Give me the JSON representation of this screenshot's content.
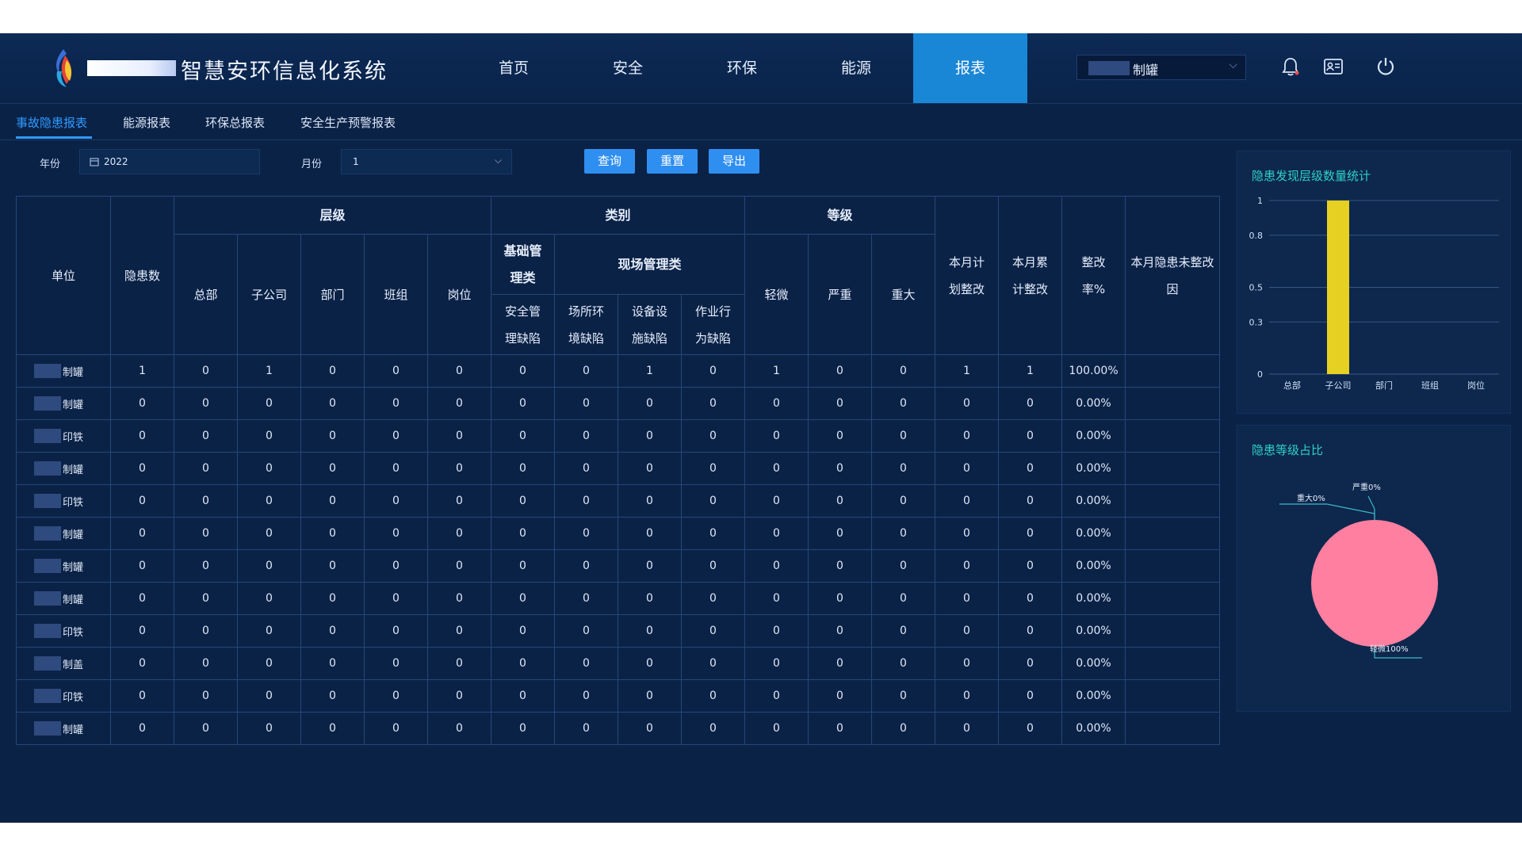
{
  "app": {
    "title": "智慧安环信息化系统",
    "nav": [
      "首页",
      "安全",
      "环保",
      "能源",
      "报表"
    ],
    "active_nav": "报表",
    "org_select": {
      "value": "制罐"
    }
  },
  "subtabs": [
    "事故隐患报表",
    "能源报表",
    "环保总报表",
    "安全生产预警报表"
  ],
  "filters": {
    "year_label": "年份",
    "year_value": "2022",
    "month_label": "月份",
    "month_value": "1",
    "buttons": {
      "query": "查询",
      "reset": "重置",
      "export": "导出"
    }
  },
  "table": {
    "headers": {
      "unit": "单位",
      "count": "隐患数",
      "level_group": "层级",
      "level_cols": [
        "总部",
        "子公司",
        "部门",
        "班组",
        "岗位"
      ],
      "category_group": "类别",
      "basic_mgmt": [
        "基础管",
        "理类"
      ],
      "site_mgmt": "现场管理类",
      "category_cols": [
        [
          "安全管",
          "理缺陷"
        ],
        [
          "场所环",
          "境缺陷"
        ],
        [
          "设备设",
          "施缺陷"
        ],
        [
          "作业行",
          "为缺陷"
        ]
      ],
      "grade_group": "等级",
      "grade_cols": [
        "轻微",
        "严重",
        "重大"
      ],
      "plan": [
        "本月计",
        "划整改"
      ],
      "cumulative": [
        "本月累",
        "计整改"
      ],
      "rate": [
        "整改",
        "率%"
      ],
      "reason": [
        "本月隐患未整改",
        "因"
      ]
    },
    "rows": [
      {
        "unit": "制罐",
        "values": [
          "1",
          "0",
          "1",
          "0",
          "0",
          "0",
          "0",
          "0",
          "1",
          "0",
          "1",
          "0",
          "0",
          "1",
          "1",
          "100.00%",
          ""
        ]
      },
      {
        "unit": "制罐",
        "values": [
          "0",
          "0",
          "0",
          "0",
          "0",
          "0",
          "0",
          "0",
          "0",
          "0",
          "0",
          "0",
          "0",
          "0",
          "0",
          "0.00%",
          ""
        ]
      },
      {
        "unit": "印铁",
        "values": [
          "0",
          "0",
          "0",
          "0",
          "0",
          "0",
          "0",
          "0",
          "0",
          "0",
          "0",
          "0",
          "0",
          "0",
          "0",
          "0.00%",
          ""
        ]
      },
      {
        "unit": "制罐",
        "values": [
          "0",
          "0",
          "0",
          "0",
          "0",
          "0",
          "0",
          "0",
          "0",
          "0",
          "0",
          "0",
          "0",
          "0",
          "0",
          "0.00%",
          ""
        ]
      },
      {
        "unit": "印铁",
        "values": [
          "0",
          "0",
          "0",
          "0",
          "0",
          "0",
          "0",
          "0",
          "0",
          "0",
          "0",
          "0",
          "0",
          "0",
          "0",
          "0.00%",
          ""
        ]
      },
      {
        "unit": "制罐",
        "values": [
          "0",
          "0",
          "0",
          "0",
          "0",
          "0",
          "0",
          "0",
          "0",
          "0",
          "0",
          "0",
          "0",
          "0",
          "0",
          "0.00%",
          ""
        ]
      },
      {
        "unit": "制罐",
        "values": [
          "0",
          "0",
          "0",
          "0",
          "0",
          "0",
          "0",
          "0",
          "0",
          "0",
          "0",
          "0",
          "0",
          "0",
          "0",
          "0.00%",
          ""
        ]
      },
      {
        "unit": "制罐",
        "values": [
          "0",
          "0",
          "0",
          "0",
          "0",
          "0",
          "0",
          "0",
          "0",
          "0",
          "0",
          "0",
          "0",
          "0",
          "0",
          "0.00%",
          ""
        ]
      },
      {
        "unit": "印铁",
        "values": [
          "0",
          "0",
          "0",
          "0",
          "0",
          "0",
          "0",
          "0",
          "0",
          "0",
          "0",
          "0",
          "0",
          "0",
          "0",
          "0.00%",
          ""
        ]
      },
      {
        "unit": "制盖",
        "values": [
          "0",
          "0",
          "0",
          "0",
          "0",
          "0",
          "0",
          "0",
          "0",
          "0",
          "0",
          "0",
          "0",
          "0",
          "0",
          "0.00%",
          ""
        ]
      },
      {
        "unit": "印铁",
        "values": [
          "0",
          "0",
          "0",
          "0",
          "0",
          "0",
          "0",
          "0",
          "0",
          "0",
          "0",
          "0",
          "0",
          "0",
          "0",
          "0.00%",
          ""
        ]
      },
      {
        "unit": "制罐",
        "values": [
          "0",
          "0",
          "0",
          "0",
          "0",
          "0",
          "0",
          "0",
          "0",
          "0",
          "0",
          "0",
          "0",
          "0",
          "0",
          "0.00%",
          ""
        ]
      }
    ]
  },
  "chart_data": [
    {
      "type": "bar",
      "title": "隐患发现层级数量统计",
      "categories": [
        "总部",
        "子公司",
        "部门",
        "班组",
        "岗位"
      ],
      "values": [
        0,
        1,
        0,
        0,
        0
      ],
      "yticks": [
        "1",
        "0.8",
        "0.5",
        "0.3",
        "0"
      ],
      "ylim": [
        0,
        1
      ],
      "grid": true,
      "bar_color": "#e6d021"
    },
    {
      "type": "pie",
      "title": "隐患等级占比",
      "slices": [
        {
          "label": "轻微100%",
          "value": 100,
          "color": "#ff7fa0"
        },
        {
          "label": "严重0%",
          "value": 0
        },
        {
          "label": "重大0%",
          "value": 0
        }
      ]
    }
  ],
  "colors": {
    "background": "#0b2247",
    "accent": "#1a86d6",
    "button": "#2f8ff1",
    "panel_title": "#2fd0c6"
  }
}
